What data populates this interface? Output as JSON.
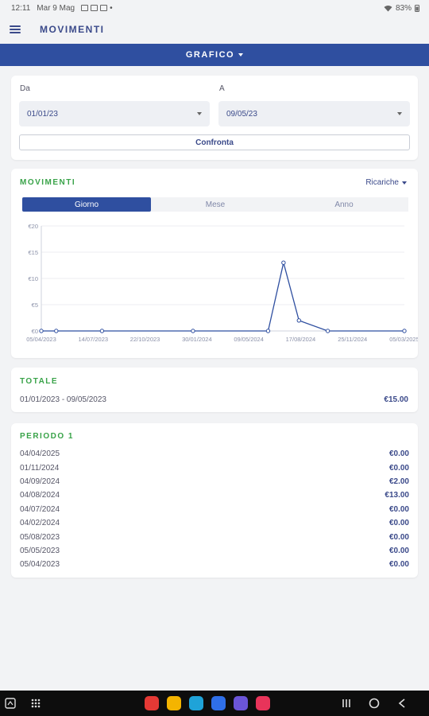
{
  "status": {
    "time": "12:11",
    "date": "Mar 9 Mag",
    "dot": "•",
    "battery": "83%"
  },
  "header": {
    "title": "MOVIMENTI"
  },
  "view_selector": {
    "label": "GRAFICO"
  },
  "dates": {
    "from_label": "Da",
    "from_value": "01/01/23",
    "to_label": "A",
    "to_value": "09/05/23",
    "compare_label": "Confronta"
  },
  "chart_card": {
    "title": "MOVIMENTI",
    "filter": "Ricariche",
    "tabs": [
      {
        "label": "Giorno"
      },
      {
        "label": "Mese"
      },
      {
        "label": "Anno"
      }
    ]
  },
  "chart_data": {
    "type": "line",
    "y_ticks": [
      "€0",
      "€5",
      "€10",
      "€15",
      "€20"
    ],
    "ylim": [
      0,
      20
    ],
    "x_ticks": [
      "05/04/2023",
      "14/07/2023",
      "22/10/2023",
      "30/01/2024",
      "09/05/2024",
      "17/08/2024",
      "25/11/2024",
      "05/03/2025"
    ],
    "series": [
      {
        "points": [
          {
            "x": "2023-04-05",
            "y": 0
          },
          {
            "x": "2023-05-05",
            "y": 0
          },
          {
            "x": "2023-08-05",
            "y": 0
          },
          {
            "x": "2024-02-04",
            "y": 0
          },
          {
            "x": "2024-07-04",
            "y": 0
          },
          {
            "x": "2024-08-04",
            "y": 13
          },
          {
            "x": "2024-09-04",
            "y": 2
          },
          {
            "x": "2024-11-01",
            "y": 0
          },
          {
            "x": "2025-04-04",
            "y": 0
          }
        ]
      }
    ],
    "xlim": [
      "2023-04-05",
      "2025-04-04"
    ],
    "colors": {
      "line": "#2f4fa0",
      "grid": "#eceef2",
      "tick": "#8a90a8"
    },
    "grid": true
  },
  "totale": {
    "title": "TOTALE",
    "range": "01/01/2023 - 09/05/2023",
    "amount": "€15.00"
  },
  "periodo": {
    "title": "PERIODO 1",
    "rows": [
      {
        "date": "04/04/2025",
        "amount": "€0.00"
      },
      {
        "date": "01/11/2024",
        "amount": "€0.00"
      },
      {
        "date": "04/09/2024",
        "amount": "€2.00"
      },
      {
        "date": "04/08/2024",
        "amount": "€13.00"
      },
      {
        "date": "04/07/2024",
        "amount": "€0.00"
      },
      {
        "date": "04/02/2024",
        "amount": "€0.00"
      },
      {
        "date": "05/08/2023",
        "amount": "€0.00"
      },
      {
        "date": "05/05/2023",
        "amount": "€0.00"
      },
      {
        "date": "05/04/2023",
        "amount": "€0.00"
      }
    ]
  },
  "nav": {
    "apps": [
      {
        "name": "red-app-icon",
        "color": "#e53935"
      },
      {
        "name": "notes-app-icon",
        "color": "#f4b400"
      },
      {
        "name": "calendar-app-icon",
        "color": "#1fa3d8"
      },
      {
        "name": "messages-app-icon",
        "color": "#2f6fe8"
      },
      {
        "name": "browser-app-icon",
        "color": "#6b55d8"
      },
      {
        "name": "media-app-icon",
        "color": "#e8345a"
      }
    ]
  }
}
